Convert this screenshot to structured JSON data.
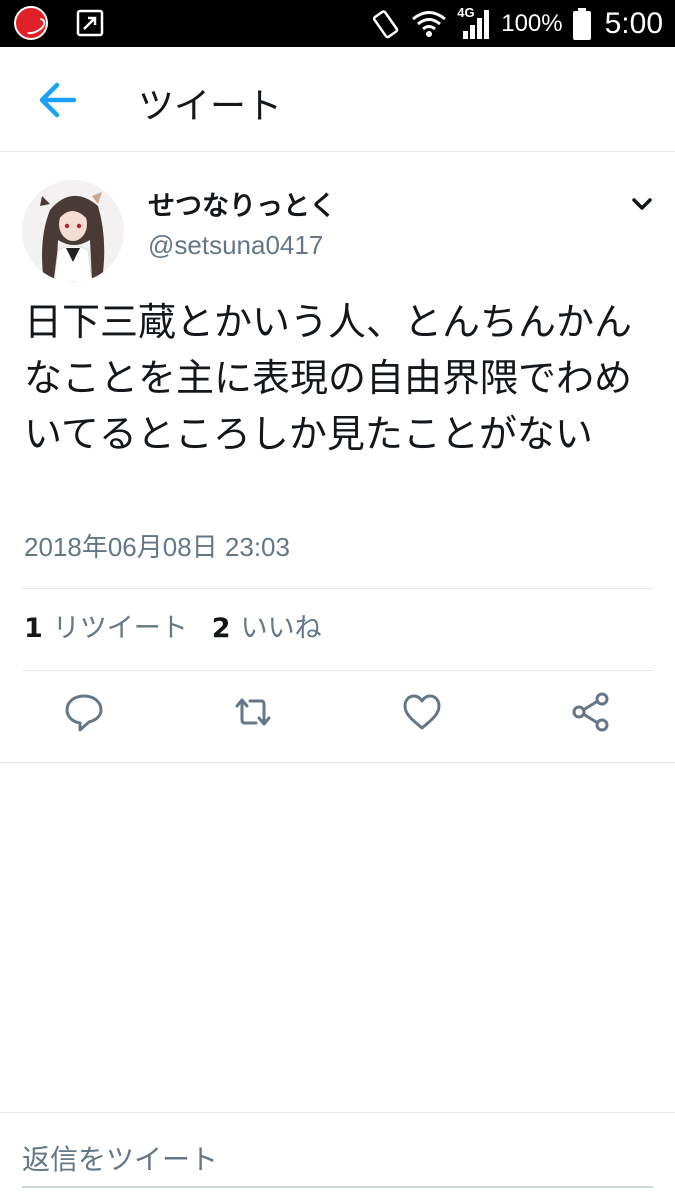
{
  "status_bar": {
    "network": "4G",
    "battery": "100%",
    "time": "5:00"
  },
  "header": {
    "title": "ツイート"
  },
  "tweet": {
    "display_name": "せつなりっとく",
    "handle": "@setsuna0417",
    "text": "日下三蔵とかいう人、とんちんかんなことを主に表現の自由界隈でわめいてるところしか見たことがない",
    "timestamp": "2018年06月08日 23:03",
    "retweet_count": "1",
    "retweet_label": "リツイート",
    "like_count": "2",
    "like_label": "いいね"
  },
  "reply": {
    "placeholder": "返信をツイート"
  },
  "colors": {
    "accent": "#1da1f2",
    "icon_gray": "#657786",
    "text": "#14171a",
    "divider": "#e1e8ed"
  }
}
